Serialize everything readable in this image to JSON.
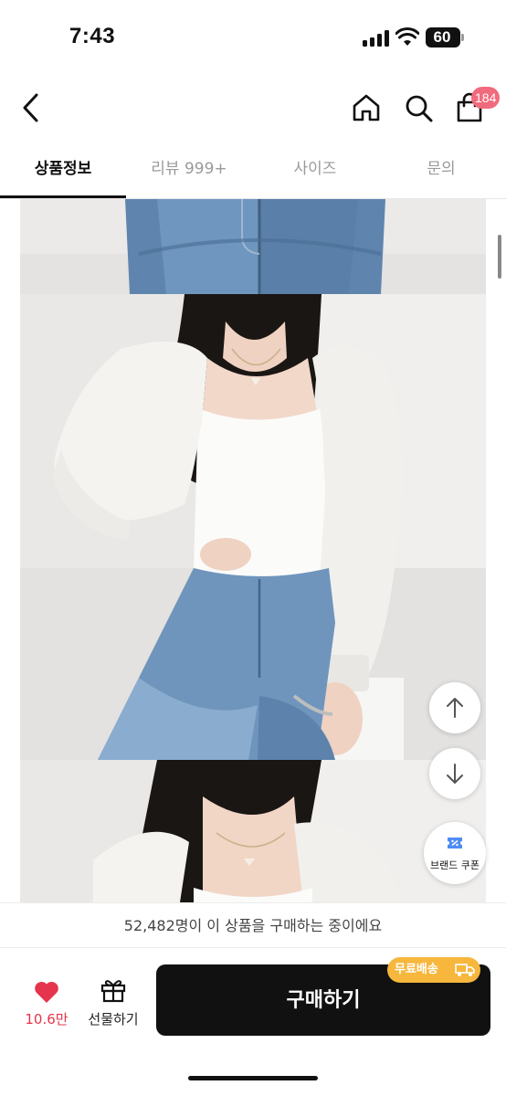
{
  "status_bar": {
    "time": "7:43",
    "battery": "60"
  },
  "nav": {
    "cart_count": "184",
    "icons": [
      "back-icon",
      "home-icon",
      "search-icon",
      "shopping-bag-icon"
    ]
  },
  "tabs": [
    {
      "label": "상품정보",
      "active": true
    },
    {
      "label": "리뷰 999+",
      "active": false
    },
    {
      "label": "사이즈",
      "active": false
    },
    {
      "label": "문의",
      "active": false
    }
  ],
  "floating": {
    "coupon_label": "브랜드 쿠폰",
    "icons": [
      "arrow-up-icon",
      "arrow-down-icon",
      "coupon-icon"
    ]
  },
  "footer": {
    "buyers_text": "52,482명이 이 상품을 구매하는 중이에요",
    "like_count": "10.6만",
    "gift_label": "선물하기",
    "buy_label": "구매하기",
    "shipping_badge": "무료배송"
  },
  "colors": {
    "accent_red": "#e5354c",
    "badge_pink": "#f16a7d",
    "shipping_orange": "#f7b63c",
    "buy_button": "#111111"
  }
}
